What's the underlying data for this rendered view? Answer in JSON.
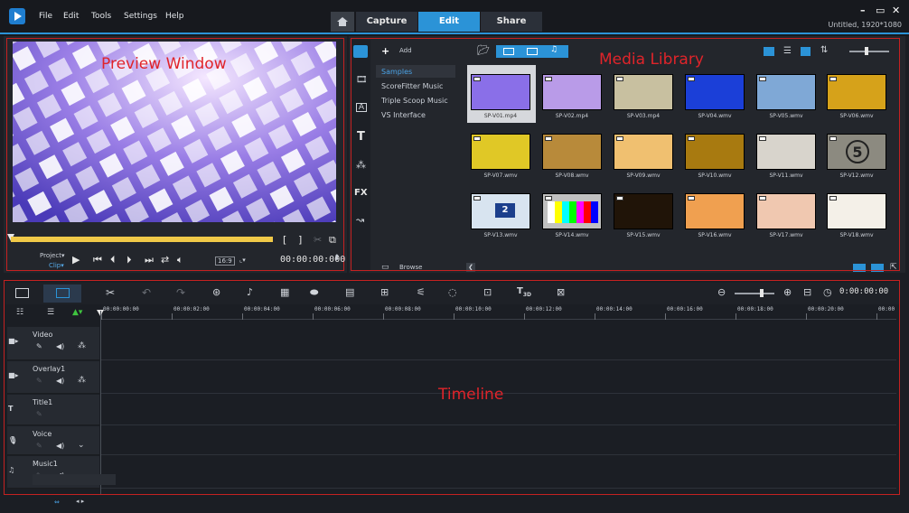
{
  "menu": {
    "file": "File",
    "edit": "Edit",
    "tools": "Tools",
    "settings": "Settings",
    "help": "Help"
  },
  "tabs": {
    "capture": "Capture",
    "edit": "Edit",
    "share": "Share"
  },
  "window": {
    "title": "Untitled, 1920*1080",
    "minimize": "–",
    "restore": "▭",
    "close": "✕"
  },
  "preview": {
    "label": "Preview Window",
    "project": "Project",
    "clip": "Clip",
    "aspect": "16:9",
    "timecode": "00:00:00:000",
    "bracket_in": "[",
    "bracket_out": "]"
  },
  "library": {
    "label": "Media Library",
    "add": "Add",
    "browse": "Browse",
    "folders": [
      "Samples",
      "ScoreFitter Music",
      "Triple Scoop Music",
      "VS Interface"
    ],
    "side_icons": [
      "media-icon",
      "instant-project-icon",
      "transition-icon",
      "title-icon",
      "graphic-icon",
      "filter-icon",
      "path-icon"
    ],
    "side_text": {
      "title": "T",
      "fx": "FX"
    },
    "thumbs": [
      {
        "name": "SP-V01.mp4",
        "color": "#8a6fe8"
      },
      {
        "name": "SP-V02.mp4",
        "color": "#b99be8"
      },
      {
        "name": "SP-V03.mp4",
        "color": "#c8c0a0"
      },
      {
        "name": "SP-V04.wmv",
        "color": "#1b3fd8"
      },
      {
        "name": "SP-V05.wmv",
        "color": "#7fa8d6"
      },
      {
        "name": "SP-V06.wmv",
        "color": "#d6a21a"
      },
      {
        "name": "SP-V07.wmv",
        "color": "#e0c826"
      },
      {
        "name": "SP-V08.wmv",
        "color": "#b88a3a"
      },
      {
        "name": "SP-V09.wmv",
        "color": "#f0c070"
      },
      {
        "name": "SP-V10.wmv",
        "color": "#a87a10"
      },
      {
        "name": "SP-V11.wmv",
        "color": "#d8d4cc"
      },
      {
        "name": "SP-V12.wmv",
        "color": "#8c8a80"
      },
      {
        "name": "SP-V13.wmv",
        "color": "#d8e4f0"
      },
      {
        "name": "SP-V14.wmv",
        "color": "#c0c0c0"
      },
      {
        "name": "SP-V15.wmv",
        "color": "#201408"
      },
      {
        "name": "SP-V16.wmv",
        "color": "#f0a050"
      },
      {
        "name": "SP-V17.wmv",
        "color": "#f0c8b0"
      },
      {
        "name": "SP-V18.wmv",
        "color": "#f4f0e8"
      }
    ],
    "v12_number": "5",
    "v13_number": "2"
  },
  "timeline": {
    "label": "Timeline",
    "zoom_timecode": "0:00:00:00",
    "ruler": [
      "00:00:00:00",
      "00:00:02:00",
      "00:00:04:00",
      "00:00:06:00",
      "00:00:08:00",
      "00:00:10:00",
      "00:00:12:00",
      "00:00:14:00",
      "00:00:16:00",
      "00:00:18:00",
      "00:00:20:00",
      "00:00"
    ],
    "tracks": [
      {
        "name": "Video",
        "icon": "video-camera-icon"
      },
      {
        "name": "Overlay1",
        "icon": "overlay-camera-icon"
      },
      {
        "name": "Title1",
        "icon": "title-track-icon"
      },
      {
        "name": "Voice",
        "icon": "microphone-icon"
      },
      {
        "name": "Music1",
        "icon": "music-note-icon"
      }
    ],
    "title_track_letter": "T",
    "toolbar_3d_label": "3D"
  },
  "colors": {
    "accent": "#2b93d7",
    "annotation": "#e0242a",
    "scrub": "#f0c948"
  }
}
